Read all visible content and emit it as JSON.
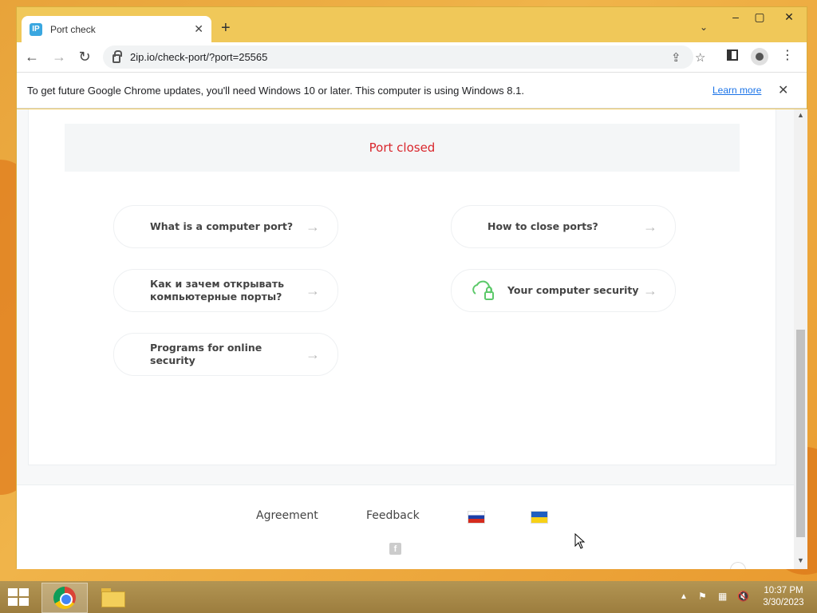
{
  "browser": {
    "tab": {
      "title": "Port check",
      "favicon_text": "IP"
    },
    "url": "2ip.io/check-port/?port=25565",
    "infobar": {
      "message": "To get future Google Chrome updates, you'll need Windows 10 or later. This computer is using Windows 8.1.",
      "learn_more": "Learn more"
    }
  },
  "page": {
    "status": "Port closed",
    "status_color": "#d9262c",
    "links": [
      {
        "label": "What is a computer port?"
      },
      {
        "label": "How to close ports?"
      },
      {
        "label": "Как и зачем открывать компьютерные порты?"
      },
      {
        "label": "Your computer security",
        "icon": "cloud-lock-icon"
      },
      {
        "label": "Programs for online security"
      }
    ],
    "arrow": "→",
    "footer": {
      "agreement": "Agreement",
      "feedback": "Feedback",
      "flags": [
        "ru-flag-icon",
        "ua-flag-icon"
      ]
    }
  },
  "taskbar": {
    "time": "10:37 PM",
    "date": "3/30/2023"
  }
}
